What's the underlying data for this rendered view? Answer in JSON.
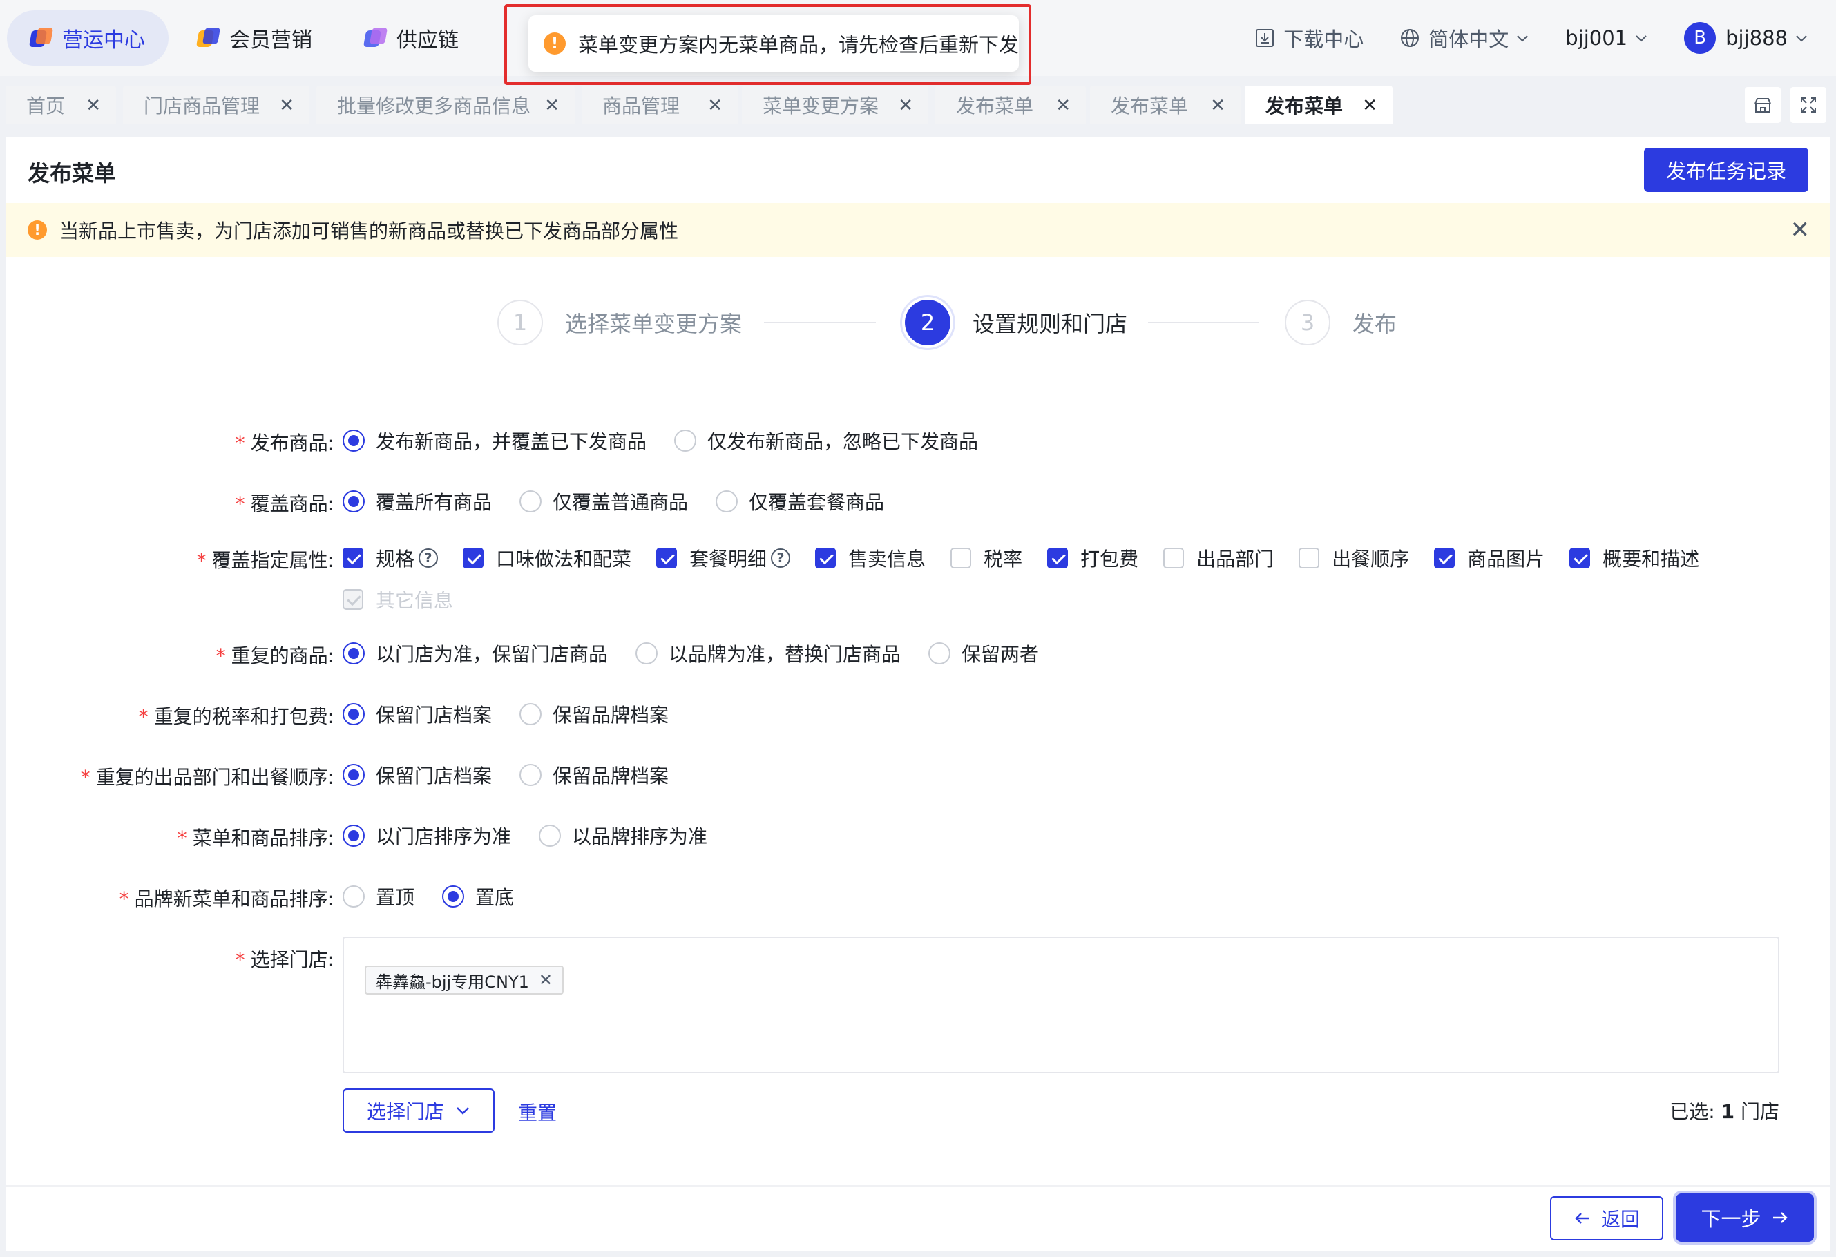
{
  "topnav": {
    "items": [
      {
        "label": "营运中心",
        "active": true
      },
      {
        "label": "会员营销",
        "active": false
      },
      {
        "label": "供应链",
        "active": false
      }
    ],
    "download_center": "下载中心",
    "language": "简体中文",
    "account": "bjj001",
    "avatar_letter": "B",
    "user": "bjj888"
  },
  "toast": {
    "message": "菜单变更方案内无菜单商品，请先检查后重新下发"
  },
  "tabs": [
    {
      "label": "首页"
    },
    {
      "label": "门店商品管理"
    },
    {
      "label": "批量修改更多商品信息"
    },
    {
      "label": "商品管理"
    },
    {
      "label": "菜单变更方案"
    },
    {
      "label": "发布菜单"
    },
    {
      "label": "发布菜单"
    },
    {
      "label": "发布菜单",
      "active": true
    }
  ],
  "page": {
    "title": "发布菜单",
    "task_record_button": "发布任务记录",
    "alert": "当新品上市售卖，为门店添加可销售的新商品或替换已下发商品部分属性"
  },
  "steps": [
    {
      "num": "1",
      "label": "选择菜单变更方案"
    },
    {
      "num": "2",
      "label": "设置规则和门店",
      "active": true
    },
    {
      "num": "3",
      "label": "发布"
    }
  ],
  "form": {
    "publish_goods": {
      "label": "发布商品:",
      "options": [
        "发布新商品，并覆盖已下发商品",
        "仅发布新商品，忽略已下发商品"
      ],
      "selected": 0
    },
    "cover_goods": {
      "label": "覆盖商品:",
      "options": [
        "覆盖所有商品",
        "仅覆盖普通商品",
        "仅覆盖套餐商品"
      ],
      "selected": 0
    },
    "cover_attrs": {
      "label": "覆盖指定属性:",
      "options": [
        {
          "label": "规格",
          "checked": true,
          "help": true
        },
        {
          "label": "口味做法和配菜",
          "checked": true
        },
        {
          "label": "套餐明细",
          "checked": true,
          "help": true
        },
        {
          "label": "售卖信息",
          "checked": true
        },
        {
          "label": "税率",
          "checked": false
        },
        {
          "label": "打包费",
          "checked": true
        },
        {
          "label": "出品部门",
          "checked": false
        },
        {
          "label": "出餐顺序",
          "checked": false
        },
        {
          "label": "商品图片",
          "checked": true
        },
        {
          "label": "概要和描述",
          "checked": true
        }
      ],
      "other": "其它信息"
    },
    "duplicate_goods": {
      "label": "重复的商品:",
      "options": [
        "以门店为准，保留门店商品",
        "以品牌为准，替换门店商品",
        "保留两者"
      ],
      "selected": 0
    },
    "duplicate_tax": {
      "label": "重复的税率和打包费:",
      "options": [
        "保留门店档案",
        "保留品牌档案"
      ],
      "selected": 0
    },
    "duplicate_dept": {
      "label": "重复的出品部门和出餐顺序:",
      "options": [
        "保留门店档案",
        "保留品牌档案"
      ],
      "selected": 0
    },
    "menu_sort": {
      "label": "菜单和商品排序:",
      "options": [
        "以门店排序为准",
        "以品牌排序为准"
      ],
      "selected": 0
    },
    "brand_sort": {
      "label": "品牌新菜单和商品排序:",
      "options": [
        "置顶",
        "置底"
      ],
      "selected": 1
    },
    "stores": {
      "label": "选择门店:",
      "tags": [
        "犇羴鱻-bjj专用CNY1"
      ],
      "select_button": "选择门店",
      "reset": "重置",
      "selected_prefix": "已选: ",
      "selected_count": "1",
      "selected_suffix": " 门店"
    }
  },
  "footer": {
    "back": "返回",
    "next": "下一步"
  },
  "colors": {
    "primary": "#2c3be0",
    "required": "#f53f3f",
    "warning": "#ff9a2e",
    "alert_bg": "#fffbe6"
  }
}
